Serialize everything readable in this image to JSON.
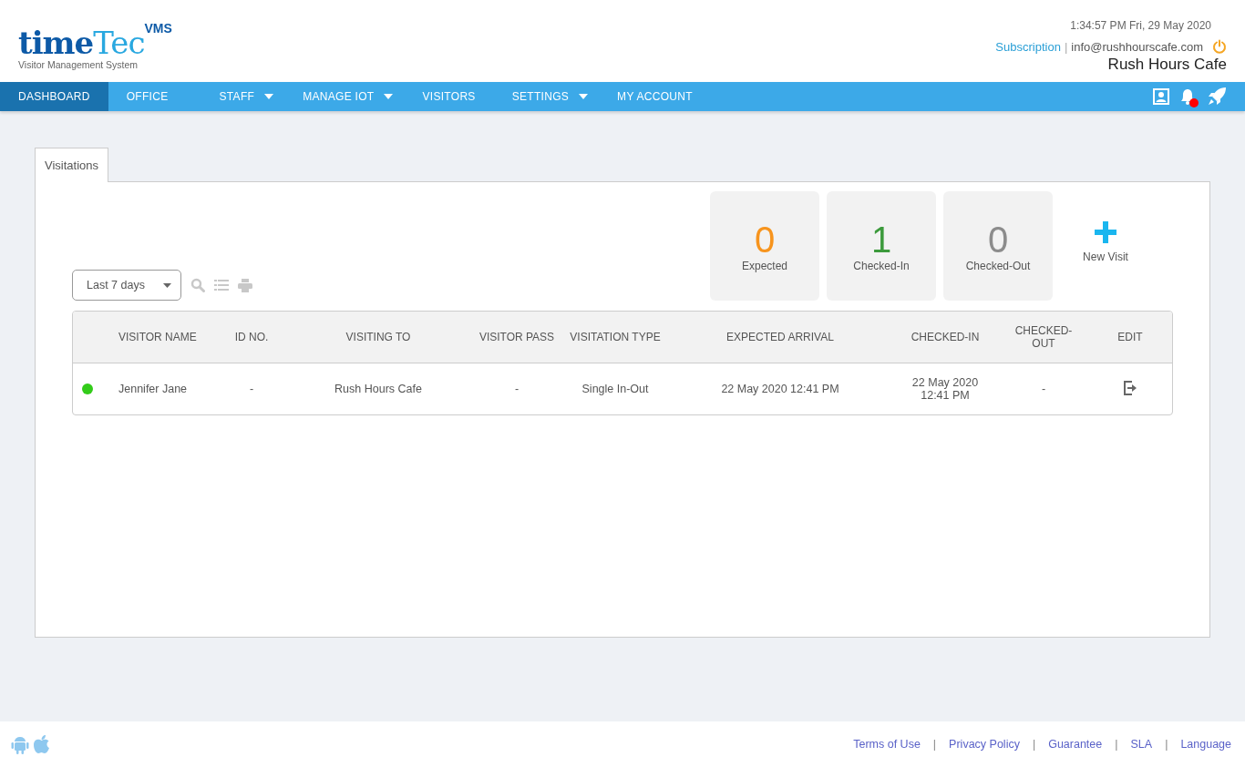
{
  "logo": {
    "word_dark": "time",
    "word_light": "Tec",
    "badge": "VMS",
    "tagline": "Visitor Management System"
  },
  "header": {
    "datetime": "1:34:57 PM  Fri, 29 May 2020",
    "subscription_link": "Subscription",
    "separator": "|",
    "email": "info@rushhourscafe.com",
    "company": "Rush Hours Cafe"
  },
  "nav": [
    {
      "label": "DASHBOARD",
      "selected": true,
      "dropdown": false
    },
    {
      "label": "OFFICE",
      "selected": false,
      "dropdown": false
    },
    {
      "label": "STAFF",
      "selected": false,
      "dropdown": true
    },
    {
      "label": "MANAGE IOT",
      "selected": false,
      "dropdown": true
    },
    {
      "label": "VISITORS",
      "selected": false,
      "dropdown": false
    },
    {
      "label": "SETTINGS",
      "selected": false,
      "dropdown": true
    },
    {
      "label": "MY ACCOUNT",
      "selected": false,
      "dropdown": false
    }
  ],
  "notifications": {
    "unread": true
  },
  "tabs": [
    {
      "label": "Visitations",
      "selected": true
    }
  ],
  "filter": {
    "value": "Last 7 days"
  },
  "stats": [
    {
      "count": "0",
      "label": "Expected",
      "color": "#f7941d"
    },
    {
      "count": "1",
      "label": "Checked-In",
      "color": "#3c9a3c"
    },
    {
      "count": "0",
      "label": "Checked-Out",
      "color": "#8c8c8c"
    }
  ],
  "new_visit": {
    "label": "New Visit"
  },
  "table": {
    "columns": [
      "VISITOR NAME",
      "ID NO.",
      "VISITING TO",
      "VISITOR PASS",
      "VISITATION TYPE",
      "EXPECTED ARRIVAL",
      "CHECKED-IN",
      "CHECKED-OUT",
      "EDIT"
    ],
    "rows": [
      {
        "color": "#33cc1a",
        "cells": [
          "Jennifer Jane",
          "-",
          "Rush Hours Cafe",
          "-",
          "Single In-Out",
          "22 May 2020 12:41 PM",
          "22 May 2020 12:41 PM",
          "-"
        ]
      }
    ]
  },
  "footer": {
    "separator": "|",
    "links": [
      "Terms of Use",
      "Privacy Policy",
      "Guarantee",
      "SLA",
      "Language"
    ]
  }
}
